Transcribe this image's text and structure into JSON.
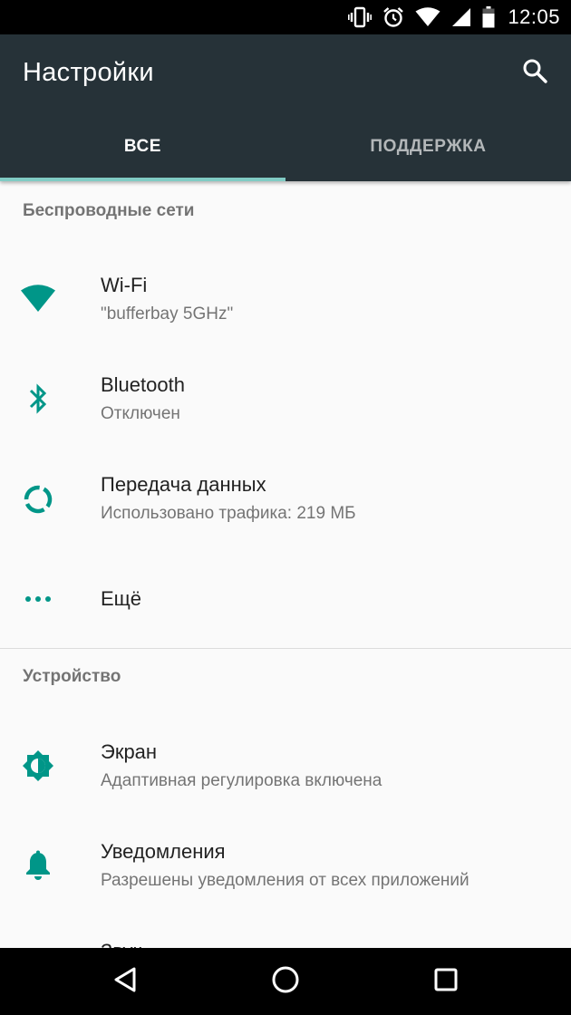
{
  "status_bar": {
    "time": "12:05",
    "icons": [
      "vibrate-icon",
      "alarm-icon",
      "wifi-icon",
      "signal-icon",
      "battery-icon"
    ]
  },
  "toolbar": {
    "title": "Настройки",
    "search_icon": "search-icon"
  },
  "tabs": [
    {
      "label": "ВСЕ",
      "active": true
    },
    {
      "label": "ПОДДЕРЖКА",
      "active": false
    }
  ],
  "sections": [
    {
      "header": "Беспроводные сети",
      "items": [
        {
          "icon": "wifi-icon",
          "title": "Wi-Fi",
          "subtitle": "\"bufferbay 5GHz\""
        },
        {
          "icon": "bluetooth-icon",
          "title": "Bluetooth",
          "subtitle": "Отключен"
        },
        {
          "icon": "data-usage-icon",
          "title": "Передача данных",
          "subtitle": "Использовано трафика: 219 МБ"
        },
        {
          "icon": "more-horiz-icon",
          "title": "Ещё"
        }
      ]
    },
    {
      "header": "Устройство",
      "items": [
        {
          "icon": "brightness-icon",
          "title": "Экран",
          "subtitle": "Адаптивная регулировка включена"
        },
        {
          "icon": "notifications-icon",
          "title": "Уведомления",
          "subtitle": "Разрешены уведомления от всех приложений"
        },
        {
          "icon": "sound-icon",
          "title": "Звук"
        }
      ]
    }
  ],
  "nav_bar": {
    "buttons": [
      "back-icon",
      "home-icon",
      "recents-icon"
    ]
  },
  "colors": {
    "toolbar": "#263238",
    "accent": "#009688",
    "tab_indicator": "#80cbc4",
    "background": "#fafafa"
  }
}
